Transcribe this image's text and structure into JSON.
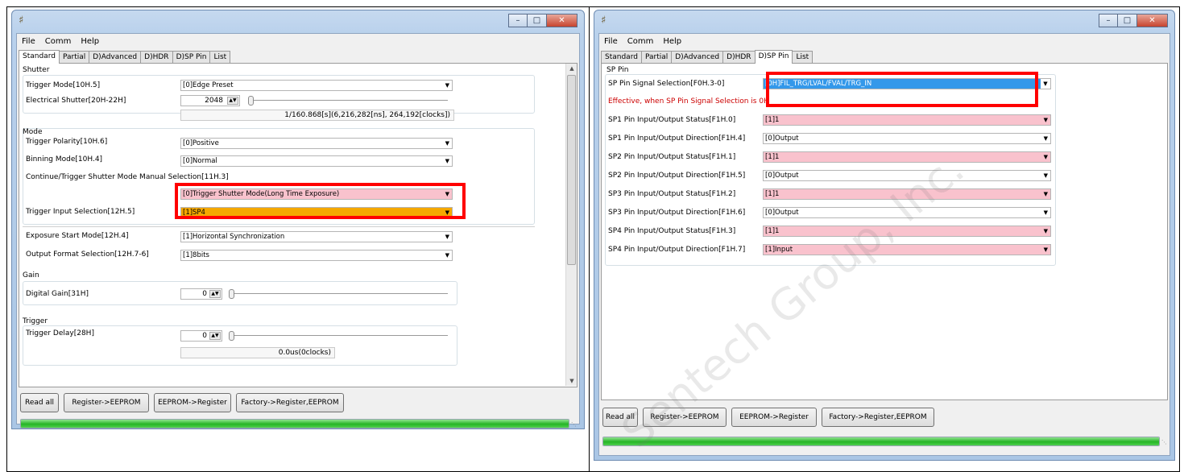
{
  "menu": [
    "File",
    "Comm",
    "Help"
  ],
  "tabs": [
    "Standard",
    "Partial",
    "D)Advanced",
    "D)HDR",
    "D)SP Pin",
    "List"
  ],
  "left": {
    "active_tab": "Standard",
    "shutter": {
      "title": "Shutter",
      "trigger_mode_label": "Trigger Mode[10H.5]",
      "trigger_mode_value": "[0]Edge Preset",
      "electrical_shutter_label": "Electrical Shutter[20H-22H]",
      "electrical_shutter_value": "2048",
      "electrical_shutter_readout": "1/160.868[s](6,216,282[ns], 264,192[clocks])"
    },
    "mode": {
      "title": "Mode",
      "trigger_polarity_label": "Trigger Polarity[10H.6]",
      "trigger_polarity_value": "[0]Positive",
      "binning_label": "Binning Mode[10H.4]",
      "binning_value": "[0]Normal",
      "continue_label": "Continue/Trigger Shutter Mode Manual Selection[11H.3]",
      "continue_value": "[0]Trigger Shutter Mode(Long Time Exposure)",
      "trigger_input_label": "Trigger Input Selection[12H.5]",
      "trigger_input_value": "[1]SP4",
      "exposure_start_label": "Exposure Start Mode[12H.4]",
      "exposure_start_value": "[1]Horizontal Synchronization",
      "output_format_label": "Output Format Selection[12H.7-6]",
      "output_format_value": "[1]8bits"
    },
    "gain": {
      "title": "Gain",
      "digital_gain_label": "Digital Gain[31H]",
      "digital_gain_value": "0"
    },
    "trigger": {
      "title": "Trigger",
      "delay_label": "Trigger Delay[28H]",
      "delay_value": "0",
      "delay_readout": "0.0us(0clocks)"
    }
  },
  "right": {
    "active_tab": "D)SP Pin",
    "group_title": "SP Pin",
    "signal_label": "SP Pin Signal Selection[F0H.3-0]",
    "signal_value": "[0H]FIL_TRG/LVAL/FVAL/TRG_IN",
    "note": "Effective, when SP Pin Signal Selection is",
    "note_suffix": "0H",
    "rows": [
      {
        "label": "SP1 Pin Input/Output Status[F1H.0]",
        "value": "[1]1"
      },
      {
        "label": "SP1 Pin Input/Output Direction[F1H.4]",
        "value": "[0]Output"
      },
      {
        "label": "SP2 Pin Input/Output Status[F1H.1]",
        "value": "[1]1"
      },
      {
        "label": "SP2 Pin Input/Output Direction[F1H.5]",
        "value": "[0]Output"
      },
      {
        "label": "SP3 Pin Input/Output Status[F1H.2]",
        "value": "[1]1"
      },
      {
        "label": "SP3 Pin Input/Output Direction[F1H.6]",
        "value": "[0]Output"
      },
      {
        "label": "SP4 Pin Input/Output Status[F1H.3]",
        "value": "[1]1"
      },
      {
        "label": "SP4 Pin Input/Output Direction[F1H.7]",
        "value": "[1]Input"
      }
    ]
  },
  "buttons": [
    "Read all",
    "Register->EEPROM",
    "EEPROM->Register",
    "Factory->Register,EEPROM"
  ],
  "progress": 1.0,
  "watermark": "Sentech Group, Inc.",
  "colors": {
    "highlight_red": "#ff0000",
    "pink_field": "#f9c2cd",
    "orange_field": "#f5a800",
    "selected_blue": "#3398ea",
    "progress_green": "#26b526"
  }
}
